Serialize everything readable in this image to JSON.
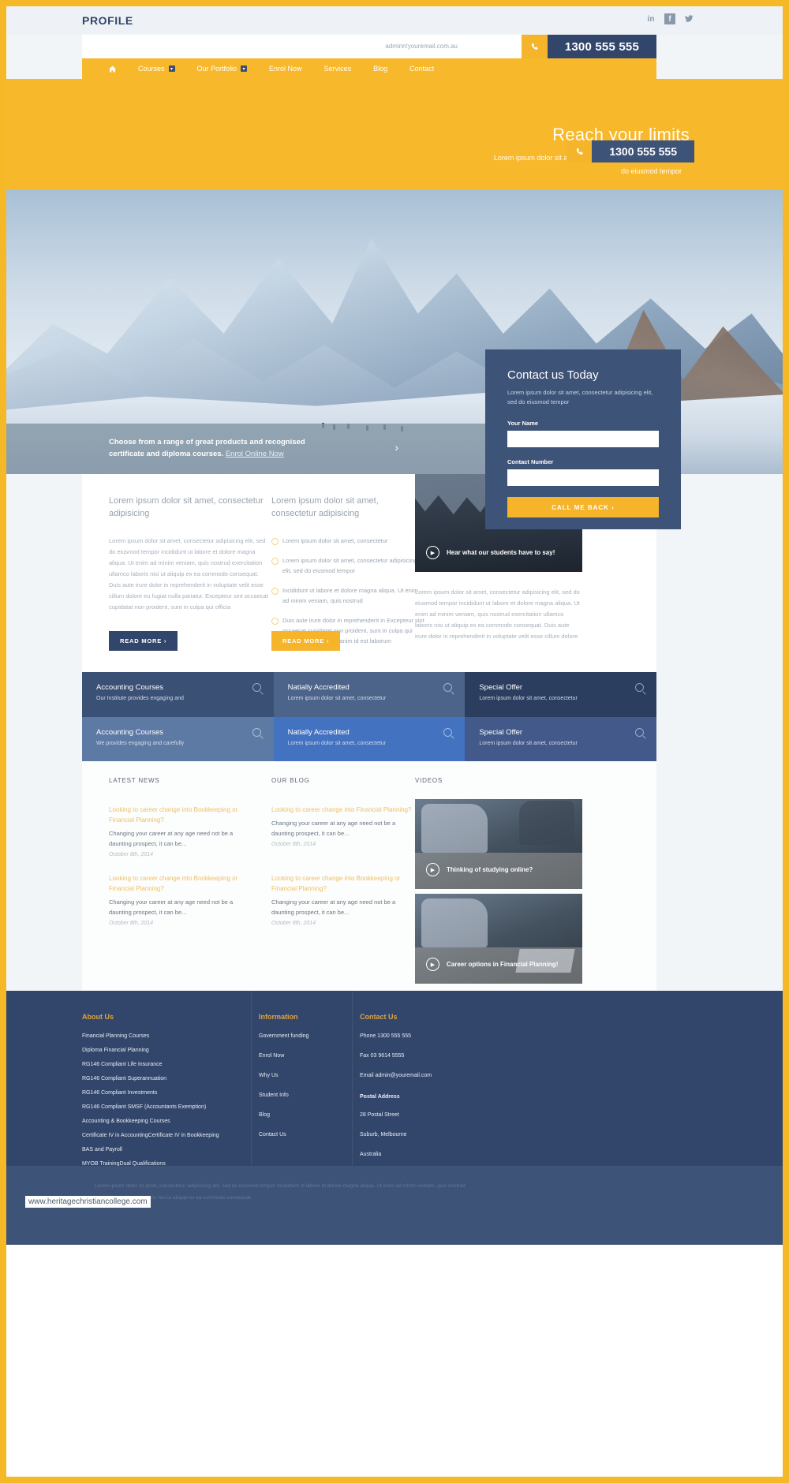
{
  "topbar": {
    "brand": "PROFILE",
    "socials": [
      {
        "name": "linkedin-icon",
        "glyph": "in"
      },
      {
        "name": "facebook-icon",
        "glyph": "f"
      },
      {
        "name": "twitter-icon",
        "glyph": "t"
      }
    ]
  },
  "header": {
    "email": "adminn!youremail.com.au",
    "phone": "1300 555 555",
    "phone_icon": "phone-icon"
  },
  "nav": {
    "items": [
      {
        "label": "",
        "icon": "home-icon",
        "caret": false
      },
      {
        "label": "Courses",
        "caret": true
      },
      {
        "label": "Our Portfolio",
        "caret": true
      },
      {
        "label": "Enrol Now",
        "caret": false
      },
      {
        "label": "Services",
        "caret": false
      },
      {
        "label": "Blog",
        "caret": false
      },
      {
        "label": "Contact",
        "caret": false
      }
    ]
  },
  "hero": {
    "title": "Reach your limits",
    "subtitle": "Lorem ipsum dolor sit amet, consectetur adipisicing elit, sed do eiusmod tempor"
  },
  "contact_card": {
    "title": "Contact us Today",
    "description": "Lorem ipsum dolor sit amet, consectetur adipisicing elit, sed do eiusmod tempor",
    "name_label": "Your Name",
    "name_value": "",
    "number_label": "Contact Number",
    "number_value": "",
    "button": "CALL ME BACK  ›"
  },
  "cta": {
    "line1": "Choose from a range of great products and recognised",
    "line2": "certificate and diploma courses.",
    "link": "Enrol Online Now",
    "arrow": "›"
  },
  "content": {
    "col1": {
      "heading": "Lorem ipsum dolor sit amet, consectetur adipisicing",
      "body": "Lorem ipsum dolor sit amet, consectetur adipisicing elit, sed do eiusmod tempor incididunt ut labore et dolore magna aliqua. Ut enim ad minim veniam, quis nostrud exercitation ullamco laboris nisi ut aliquip ex ea commodo consequat. Duis aute irure dolor in reprehenderit in voluptate velit esse cillum dolore eu fugiat nulla pariatur. Excepteur sint occaecat cupidatat non proident, sunt in culpa qui officia",
      "button": "READ MORE  ›"
    },
    "col2": {
      "heading": "Lorem ipsum dolor sit amet, consectetur adipisicing",
      "bullets": [
        "Lorem ipsum dolor sit amet, consectetur",
        "Lorem ipsum dolor sit amet, consectetur adipisicing elit, sed do eiusmod tempor",
        "Incididunt ut labore et dolore magna aliqua. Ut enim ad minim veniam, quis nostrud",
        "Duis aute irure dolor in reprehenderit in Excepteur sint occaecat cupidatat non proident, sunt in culpa qui officia deserunt mollit anim id est laborum"
      ],
      "button": "READ MORE  ›"
    },
    "col3": {
      "video_caption": "Hear what our students have to say!",
      "play_icon": "play-icon",
      "body": "Lorem ipsum dolor sit amet, consectetur adipisicing elit, sed do eiusmod tempor incididunt ut labore et dolore magna aliqua. Ut enim ad minim veniam, quis nostrud exercitation ullamco laboris nisi ut aliquip ex ea commodo consequat. Duis aute irure dolor in reprehenderit in voluptate velit esse cillum dolore"
    }
  },
  "tiles": [
    {
      "title": "Accounting Courses",
      "sub": "Our Institute provides engaging and",
      "color": "#3b5075",
      "icon": "search-icon"
    },
    {
      "title": "Natially Accredited",
      "sub": "Lorem ipsum dolor sit amet, consectetur",
      "color": "#4c6489",
      "icon": "search-icon"
    },
    {
      "title": "Special Offer",
      "sub": "Lorem ipsum dolor sit amet, consectetur",
      "color": "#2b3e60",
      "icon": "search-icon"
    },
    {
      "title": "Accounting Courses",
      "sub": "We provides engaging and carefully",
      "color": "#5d7aa5",
      "icon": "search-icon"
    },
    {
      "title": "Natially Accredited",
      "sub": "Lorem ipsum dolor sit amet, consectetur",
      "color": "#4272c0",
      "icon": "search-icon"
    },
    {
      "title": "Special Offer",
      "sub": "Lorem ipsum dolor sit amet, consectetur",
      "color": "#42598a",
      "icon": "search-icon"
    }
  ],
  "news": {
    "headings": {
      "latest": "LATEST NEWS",
      "blog": "OUR BLOG",
      "videos": "VIDEOS"
    },
    "latest": [
      {
        "title": "Looking to career change into Bookkeeping or Financial Planning?",
        "body": "Changing your career at any age need not be a daunting prospect, it can be...",
        "date": "October 8th, 2014"
      },
      {
        "title": "Looking to career change into Bookkeeping or Financial Planning?",
        "body": "Changing your career at any age need not be a daunting prospect, it can be...",
        "date": "October 8th, 2014"
      }
    ],
    "blog": [
      {
        "title": "Looking to career change into Financial Planning?",
        "body": "Changing your career at any age need not be a daunting prospect, it can be...",
        "date": "October 8th, 2014"
      },
      {
        "title": "Looking to career change into Bookkeeping or Financial Planning?",
        "body": "Changing your career at any age need not be a daunting prospect, it can be...",
        "date": "October 8th, 2014"
      }
    ],
    "videos": [
      {
        "caption": "Thinking of studying online?",
        "play_icon": "play-icon"
      },
      {
        "caption": "Career options in Financial Planning!",
        "play_icon": "play-icon"
      }
    ]
  },
  "footer": {
    "about": {
      "head": "About Us",
      "links": [
        "Financial Planning Courses",
        "Diploma Financial Planning",
        "RG146 Compliant Life Insurance",
        "RG146 Compliant Superannuation",
        "RG146 Compliant Investments",
        "RG146 Compliant SMSF (Accountants Exemption)",
        "Accounting & Bookkeeping Courses",
        "Certificate IV in AccountingCertificate IV in Bookkeeping",
        "BAS and Payroll",
        "MYOB TrainingDual Qualifications"
      ]
    },
    "information": {
      "head": "Information",
      "links": [
        "Government funding",
        "Enrol Now",
        "Why Us",
        "Student Info",
        "Blog",
        "Contact Us"
      ]
    },
    "contact": {
      "head": "Contact Us",
      "lines": [
        "Phone 1300 555 555",
        "Fax 03 9614 5555",
        "Email admin@youremail.com"
      ],
      "postal_head": "Postal Address",
      "postal": [
        "28 Postal Street",
        "Suburb, Melbourne",
        "Australia"
      ]
    },
    "phone": "1300 555 555",
    "phone_icon": "phone-icon",
    "legal": "Lorem ipsum dolor sit amet, consectetur adipisicing elit, sed do eiusmod tempor incididunt ut labore et dolore magna aliqua. Ut enim ad minim veniam, quis nostrud exercitation ullamco laboris nisi ut aliquip ex ea commodo consequat."
  },
  "watermark": "www.heritagechristiancollege.com"
}
